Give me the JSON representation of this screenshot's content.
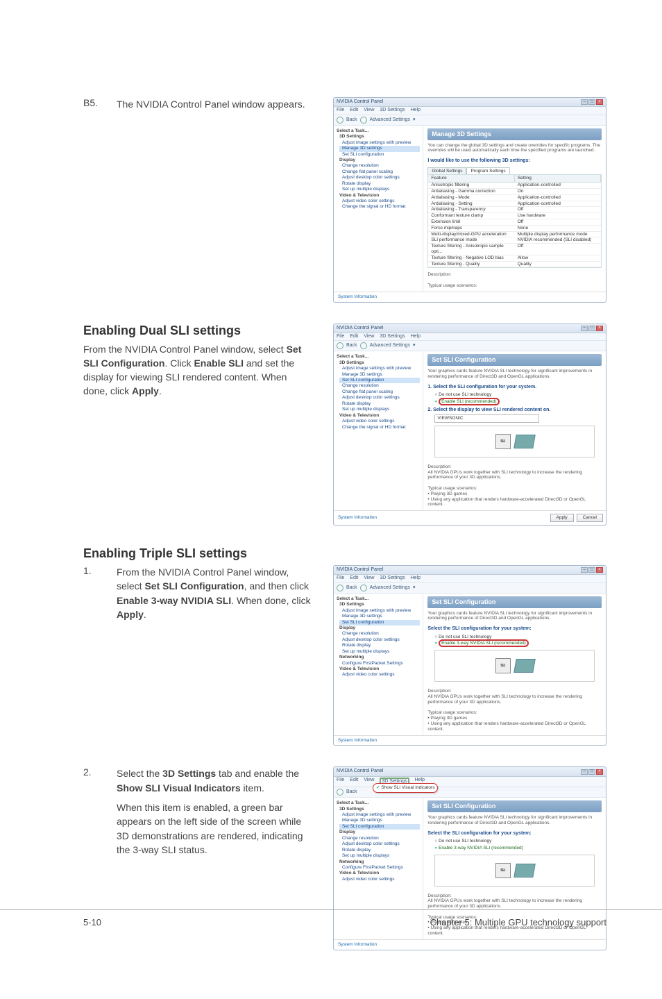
{
  "step_b5": {
    "num": "B5.",
    "text": "The NVIDIA Control Panel window appears."
  },
  "section_dual": {
    "heading": "Enabling Dual SLI settings",
    "para_pre": "From the NVIDIA Control Panel window, select ",
    "b1": "Set SLI Configuration",
    "mid1": ". Click ",
    "b2": "Enable SLI",
    "mid2": " and set the display for viewing SLI rendered content. When done, click ",
    "b3": "Apply",
    "tail": "."
  },
  "section_triple": {
    "heading": "Enabling Triple SLI settings"
  },
  "step_t1": {
    "num": "1.",
    "pre": "From the NVIDIA Control Panel window, select ",
    "b1": "Set SLI Configuration",
    "mid1": ", and then click ",
    "b2": "Enable 3-way NVIDIA SLI",
    "mid2": ". When done, click ",
    "b3": "Apply",
    "tail": "."
  },
  "step_t2": {
    "num": "2.",
    "line1_pre": "Select the ",
    "line1_b1": "3D Settings",
    "line1_mid": " tab and enable the ",
    "line1_b2": "Show SLI Visual Indicators",
    "line1_tail": " item.",
    "para2": "When this item is enabled, a green bar appears on the left side of the screen while 3D demonstrations are rendered, indicating the 3-way SLI status."
  },
  "win_common": {
    "title": "NVIDIA Control Panel",
    "menu": [
      "File",
      "Edit",
      "View",
      "3D Settings",
      "Help"
    ],
    "back": "Back",
    "adv": "Advanced Settings",
    "task_label": "Select a Task...",
    "sysinfo": "System Information",
    "apply": "Apply",
    "cancel": "Cancel"
  },
  "sidebar_items_full": [
    {
      "t": "3D Settings",
      "k": "hdr"
    },
    {
      "t": "Adjust image settings with preview"
    },
    {
      "t": "Manage 3D settings",
      "sel": true
    },
    {
      "t": "Set SLI configuration"
    },
    {
      "t": "Display",
      "k": "hdr"
    },
    {
      "t": "Change resolution"
    },
    {
      "t": "Change flat panel scaling"
    },
    {
      "t": "Adjust desktop color settings"
    },
    {
      "t": "Rotate display"
    },
    {
      "t": "Set up multiple displays"
    },
    {
      "t": "Video & Television",
      "k": "hdr"
    },
    {
      "t": "Adjust video color settings"
    },
    {
      "t": "Change the signal or HD format"
    }
  ],
  "sidebar_items_sli_dual": [
    {
      "t": "3D Settings",
      "k": "hdr"
    },
    {
      "t": "Adjust image settings with preview"
    },
    {
      "t": "Manage 3D settings"
    },
    {
      "t": "Set SLI configuration",
      "sel": true
    },
    {
      "t": "Change resolution"
    },
    {
      "t": "Change flat panel scaling"
    },
    {
      "t": "Adjust desktop color settings"
    },
    {
      "t": "Rotate display"
    },
    {
      "t": "Set up multiple displays"
    },
    {
      "t": "Video & Television",
      "k": "hdr"
    },
    {
      "t": "Adjust video color settings"
    },
    {
      "t": "Change the signal or HD format"
    }
  ],
  "sidebar_items_sli_triple": [
    {
      "t": "3D Settings",
      "k": "hdr"
    },
    {
      "t": "Adjust image settings with preview"
    },
    {
      "t": "Manage 3D settings"
    },
    {
      "t": "Set SLI configuration",
      "sel": true
    },
    {
      "t": "Display",
      "k": "hdr"
    },
    {
      "t": "Change resolution"
    },
    {
      "t": "Adjust desktop color settings"
    },
    {
      "t": "Rotate display"
    },
    {
      "t": "Set up multiple displays"
    },
    {
      "t": "Networking",
      "k": "hdr"
    },
    {
      "t": "Configure FirstPacket Settings"
    },
    {
      "t": "Video & Television",
      "k": "hdr"
    },
    {
      "t": "Adjust video color settings"
    }
  ],
  "win1": {
    "main_title": "Manage 3D Settings",
    "main_desc": "You can change the global 3D settings and create overrides for specific programs. The overrides will be used automatically each time the specified programs are launched.",
    "section": "I would like to use the following 3D settings:",
    "tabs": [
      "Global Settings",
      "Program Settings"
    ],
    "thead": [
      "Feature",
      "Setting"
    ],
    "rows": [
      [
        "Anisotropic filtering",
        "Application-controlled"
      ],
      [
        "Antialiasing - Gamma correction",
        "On"
      ],
      [
        "Antialiasing - Mode",
        "Application-controlled"
      ],
      [
        "Antialiasing - Setting",
        "Application-controlled"
      ],
      [
        "Antialiasing - Transparency",
        "Off"
      ],
      [
        "Conformant texture clamp",
        "Use hardware"
      ],
      [
        "Extension limit",
        "Off"
      ],
      [
        "Force mipmaps",
        "None"
      ],
      [
        "Multi-display/mixed-GPU acceleration",
        "Multiple display performance mode"
      ],
      [
        "SLI performance mode",
        "NVIDIA recommended (SLI disabled)"
      ],
      [
        "Texture filtering - Anisotropic sample opti...",
        "Off"
      ],
      [
        "Texture filtering - Negative LOD bias",
        "Allow"
      ],
      [
        "Texture filtering - Quality",
        "Quality"
      ]
    ],
    "desc_label": "Description:",
    "usage_label": "Typical usage scenarios:"
  },
  "win2": {
    "main_title": "Set SLI Configuration",
    "main_desc": "Your graphics cards feature NVIDIA SLI technology for significant improvements in rendering performance of Direct3D and OpenGL applications.",
    "step1": "1. Select the SLI configuration for your system.",
    "opt1": "Do not use SLI technology",
    "opt2": "Enable SLI (recommended)",
    "step2": "2. Select the display to view SLI rendered content on.",
    "display_sel": "VIEWSONIC",
    "desc_label": "Description:",
    "desc_text": "All NVIDIA GPUs work together with SLI technology to increase the rendering performance of your 3D applications.",
    "usage_label": "Typical usage scenarios:",
    "usage1": "• Playing 3D games",
    "usage2": "• Using any application that renders hardware-accelerated Direct3D or OpenGL content."
  },
  "win3": {
    "main_title": "Set SLI Configuration",
    "main_desc": "Your graphics cards feature NVIDIA SLI technology for significant improvements in rendering performance of Direct3D and OpenGL applications.",
    "step1": "Select the SLI configuration for your system:",
    "opt1": "Do not use SLI technology",
    "opt2": "Enable 3-way NVIDIA SLI (recommended)",
    "desc_label": "Description:",
    "desc_text": "All NVIDIA GPUs work together with SLI technology to increase the rendering performance of your 3D applications.",
    "usage_label": "Typical usage scenarios:",
    "usage1": "• Playing 3D games",
    "usage2": "• Using any application that renders hardware-accelerated Direct3D or OpenGL content."
  },
  "win4": {
    "menu_item": "Show SLI Visual Indicators"
  },
  "footer": {
    "left": "5-10",
    "right": "Chapter 5: Multiple GPU technology support"
  }
}
